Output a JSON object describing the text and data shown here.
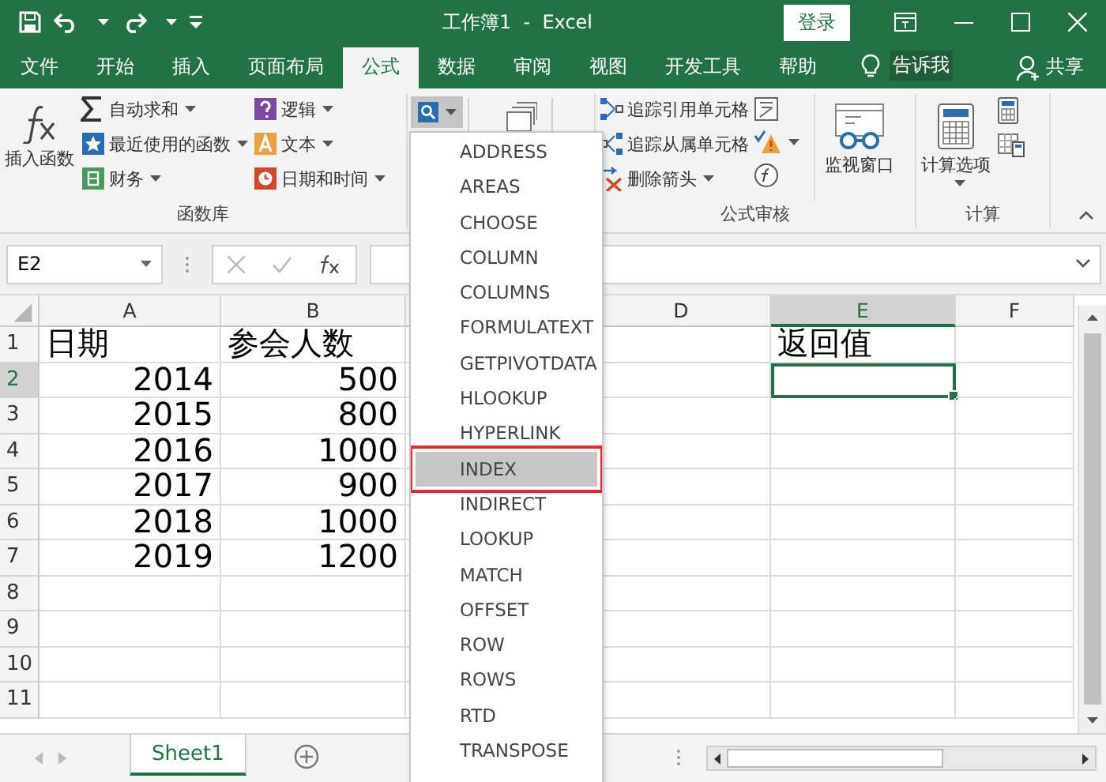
{
  "title_bar": {
    "title": "工作簿1  -  Excel",
    "login_button": "登录"
  },
  "ribbon_tabs": [
    {
      "label": "文件",
      "selected": false
    },
    {
      "label": "开始",
      "selected": false
    },
    {
      "label": "插入",
      "selected": false
    },
    {
      "label": "页面布局",
      "selected": false
    },
    {
      "label": "公式",
      "selected": true
    },
    {
      "label": "数据",
      "selected": false
    },
    {
      "label": "审阅",
      "selected": false
    },
    {
      "label": "视图",
      "selected": false
    },
    {
      "label": "开发工具",
      "selected": false
    },
    {
      "label": "帮助",
      "selected": false
    }
  ],
  "tell_me": "告诉我",
  "share": "共享",
  "function_library": {
    "label": "函数库",
    "insert_function": "插入函数",
    "buttons": [
      {
        "label": "自动求和",
        "dropdown": true
      },
      {
        "label": "最近使用的函数",
        "dropdown": true
      },
      {
        "label": "财务",
        "dropdown": true
      },
      {
        "label": "逻辑",
        "dropdown": true
      },
      {
        "label": "文本",
        "dropdown": true
      },
      {
        "label": "日期和时间",
        "dropdown": true
      }
    ]
  },
  "lookup_button": {
    "pressed": true,
    "dropdown": true
  },
  "formula_auditing": {
    "label": "公式审核",
    "buttons": [
      {
        "label": "追踪引用单元格",
        "dropdown": false
      },
      {
        "label": "追踪从属单元格",
        "dropdown": false
      },
      {
        "label": "删除箭头",
        "dropdown": true
      }
    ],
    "watch_window": "监视窗口"
  },
  "calculation": {
    "label": "计算",
    "calculation_options": "计算选项"
  },
  "formula_bar": {
    "name_box": "E2"
  },
  "columns": [
    {
      "label": "A",
      "selected": false
    },
    {
      "label": "B",
      "selected": false
    },
    {},
    {
      "label": "D",
      "selected": false
    },
    {
      "label": "E",
      "selected": true
    },
    {
      "label": "F",
      "selected": false
    }
  ],
  "rows": [
    {
      "header": "1",
      "selected": false,
      "cells": [
        {
          "text": "日期",
          "kind": "text"
        },
        {
          "text": "参会人数",
          "kind": "text"
        },
        {},
        {},
        {
          "text": "返回值",
          "kind": "text"
        },
        {}
      ]
    },
    {
      "header": "2",
      "selected": true,
      "cells": [
        {
          "text": "2014",
          "kind": "number"
        },
        {
          "text": "500",
          "kind": "number"
        },
        {},
        {},
        {},
        {}
      ]
    },
    {
      "header": "3",
      "selected": false,
      "cells": [
        {
          "text": "2015",
          "kind": "number"
        },
        {
          "text": "800",
          "kind": "number"
        },
        {},
        {},
        {},
        {}
      ]
    },
    {
      "header": "4",
      "selected": false,
      "cells": [
        {
          "text": "2016",
          "kind": "number"
        },
        {
          "text": "1000",
          "kind": "number"
        },
        {},
        {},
        {},
        {}
      ]
    },
    {
      "header": "5",
      "selected": false,
      "cells": [
        {
          "text": "2017",
          "kind": "number"
        },
        {
          "text": "900",
          "kind": "number"
        },
        {},
        {},
        {},
        {}
      ]
    },
    {
      "header": "6",
      "selected": false,
      "cells": [
        {
          "text": "2018",
          "kind": "number"
        },
        {
          "text": "1000",
          "kind": "number"
        },
        {},
        {},
        {},
        {}
      ]
    },
    {
      "header": "7",
      "selected": false,
      "cells": [
        {
          "text": "2019",
          "kind": "number"
        },
        {
          "text": "1200",
          "kind": "number"
        },
        {},
        {},
        {},
        {}
      ]
    },
    {
      "header": "8",
      "selected": false,
      "cells": [
        {},
        {},
        {},
        {},
        {},
        {}
      ]
    },
    {
      "header": "9",
      "selected": false,
      "cells": [
        {},
        {},
        {},
        {},
        {},
        {}
      ]
    },
    {
      "header": "10",
      "selected": false,
      "cells": [
        {},
        {},
        {},
        {},
        {},
        {}
      ]
    },
    {
      "header": "11",
      "selected": false,
      "cells": [
        {},
        {},
        {},
        {},
        {},
        {}
      ]
    }
  ],
  "function_menu": {
    "items": [
      {
        "label": "ADDRESS",
        "selected": false,
        "outlined": false
      },
      {
        "label": "AREAS",
        "selected": false,
        "outlined": false
      },
      {
        "label": "CHOOSE",
        "selected": false,
        "outlined": false
      },
      {
        "label": "COLUMN",
        "selected": false,
        "outlined": false
      },
      {
        "label": "COLUMNS",
        "selected": false,
        "outlined": false
      },
      {
        "label": "FORMULATEXT",
        "selected": false,
        "outlined": false
      },
      {
        "label": "GETPIVOTDATA",
        "selected": false,
        "outlined": false
      },
      {
        "label": "HLOOKUP",
        "selected": false,
        "outlined": false
      },
      {
        "label": "HYPERLINK",
        "selected": false,
        "outlined": false
      },
      {
        "label": "INDEX",
        "selected": true,
        "outlined": true
      },
      {
        "label": "INDIRECT",
        "selected": false,
        "outlined": false
      },
      {
        "label": "LOOKUP",
        "selected": false,
        "outlined": false
      },
      {
        "label": "MATCH",
        "selected": false,
        "outlined": false
      },
      {
        "label": "OFFSET",
        "selected": false,
        "outlined": false
      },
      {
        "label": "ROW",
        "selected": false,
        "outlined": false
      },
      {
        "label": "ROWS",
        "selected": false,
        "outlined": false
      },
      {
        "label": "RTD",
        "selected": false,
        "outlined": false
      },
      {
        "label": "TRANSPOSE",
        "selected": false,
        "outlined": false
      }
    ]
  },
  "sheet_tabs": [
    {
      "label": "Sheet1",
      "selected": true
    }
  ]
}
